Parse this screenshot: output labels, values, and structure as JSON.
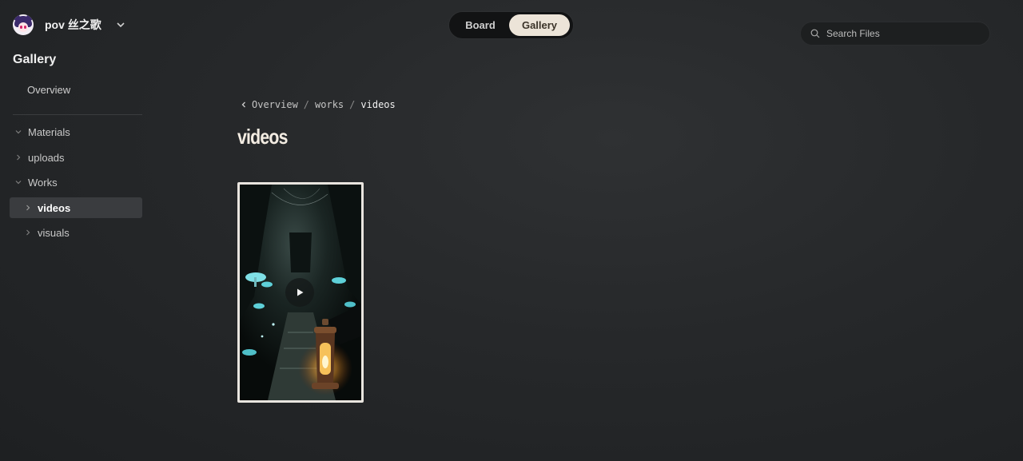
{
  "workspace": {
    "name": "pov 丝之歌"
  },
  "sidebar": {
    "section_title": "Gallery",
    "overview": "Overview",
    "tree": [
      {
        "label": "Materials",
        "expanded": true
      },
      {
        "label": "uploads",
        "expanded": false
      },
      {
        "label": "Works",
        "expanded": true
      },
      {
        "label": "videos",
        "expanded": false,
        "active": true
      },
      {
        "label": "visuals",
        "expanded": false
      }
    ]
  },
  "view_toggle": {
    "board": "Board",
    "gallery": "Gallery",
    "selected": "Gallery"
  },
  "search": {
    "placeholder": "Search Files"
  },
  "breadcrumb": {
    "items": [
      "Overview",
      "works",
      "videos"
    ]
  },
  "page": {
    "title": "videos"
  },
  "colors": {
    "accent_toggle": "#ece4d8",
    "active_item": "#3a3c3f"
  },
  "icons": {
    "chevron_down": "chevron-down-icon",
    "search": "search-icon",
    "back": "chevron-left-icon",
    "play": "play-icon"
  }
}
